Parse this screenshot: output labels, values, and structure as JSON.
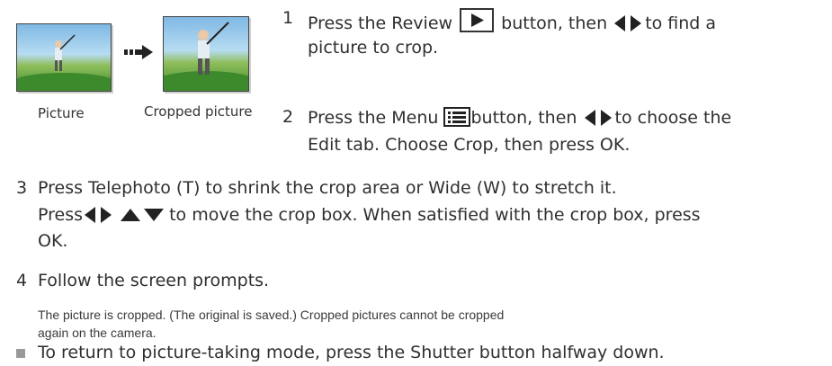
{
  "figure": {
    "original_caption": "Picture",
    "cropped_caption": "Cropped picture"
  },
  "steps": [
    {
      "number": "1",
      "line1_a": "Press the Review",
      "line1_b": "button, then",
      "line1_c": "to find a",
      "line2": "picture to crop."
    },
    {
      "number": "2",
      "line1_a": "Press the Menu",
      "line1_b": "button, then",
      "line1_c": "to choose the",
      "line2": "Edit tab. Choose Crop, then press OK."
    },
    {
      "number": "3",
      "line1": "Press Telephoto (T) to shrink the crop area or Wide (W) to stretch it.",
      "line2_a": "Press",
      "line2_b": "to move the crop box. When satisfied with the crop box, press",
      "line3": "OK."
    },
    {
      "number": "4",
      "line1": "Follow the screen prompts."
    }
  ],
  "note": {
    "line1": "The picture is cropped. (The original is saved.) Cropped pictures cannot be cropped",
    "line2": "again on the camera."
  },
  "tip": "To return to picture-taking mode, press the Shutter button halfway down.",
  "icons": [
    "review-play-icon",
    "menu-list-icon",
    "left-right-arrows-icon",
    "up-down-arrows-icon",
    "right-arrow-icon"
  ]
}
